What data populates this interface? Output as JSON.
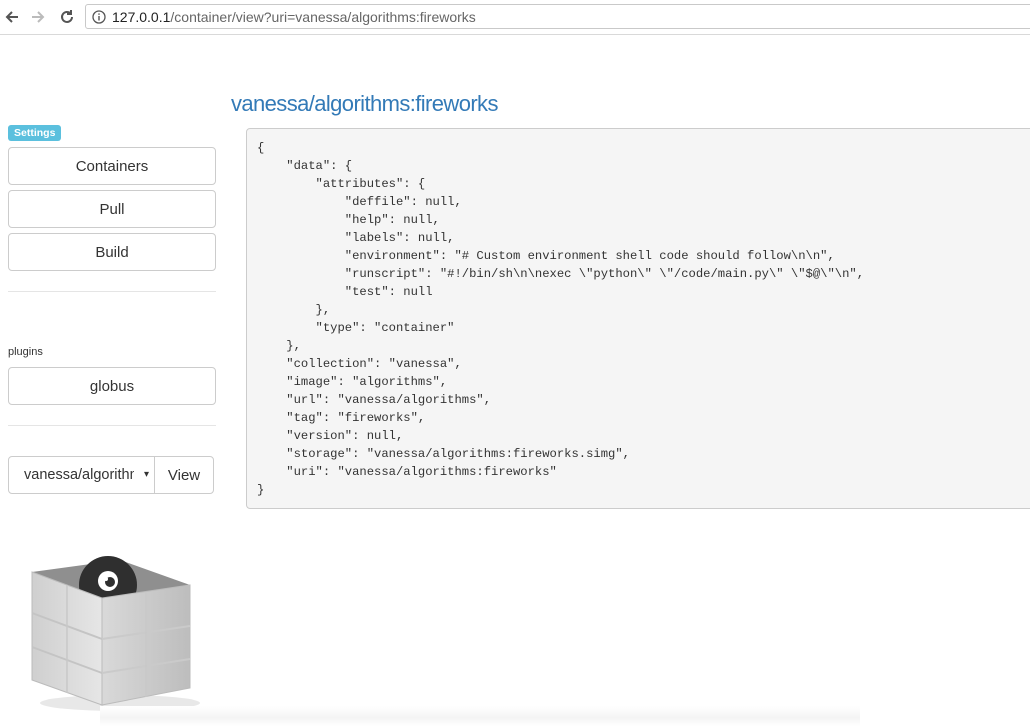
{
  "browser": {
    "url_host": "127.0.0.1",
    "url_path": "/container/view?uri=vanessa/algorithms:fireworks"
  },
  "page": {
    "title": "vanessa/algorithms:fireworks"
  },
  "sidebar": {
    "settings_badge": "Settings",
    "buttons": [
      {
        "label": "Containers"
      },
      {
        "label": "Pull"
      },
      {
        "label": "Build"
      }
    ],
    "plugins_label": "plugins",
    "plugins": [
      {
        "label": "globus"
      }
    ],
    "select_value": "vanessa/algorithms:fireworks",
    "select_arrow": "▾",
    "view_label": "View"
  },
  "json_lines": [
    "{",
    "    \"data\": {",
    "        \"attributes\": {",
    "            \"deffile\": null,",
    "            \"help\": null,",
    "            \"labels\": null,",
    "            \"environment\": \"# Custom environment shell code should follow\\n\\n\",",
    "            \"runscript\": \"#!/bin/sh\\n\\nexec \\\"python\\\" \\\"/code/main.py\\\" \\\"$@\\\"\\n\",",
    "            \"test\": null",
    "        },",
    "        \"type\": \"container\"",
    "    },",
    "    \"collection\": \"vanessa\",",
    "    \"image\": \"algorithms\",",
    "    \"url\": \"vanessa/algorithms\",",
    "    \"tag\": \"fireworks\",",
    "    \"version\": null,",
    "    \"storage\": \"vanessa/algorithms:fireworks.simg\",",
    "    \"uri\": \"vanessa/algorithms:fireworks\"",
    "}"
  ],
  "colors": {
    "link": "#337ab7",
    "badge": "#5bc0de",
    "code_bg": "#f5f5f5"
  }
}
